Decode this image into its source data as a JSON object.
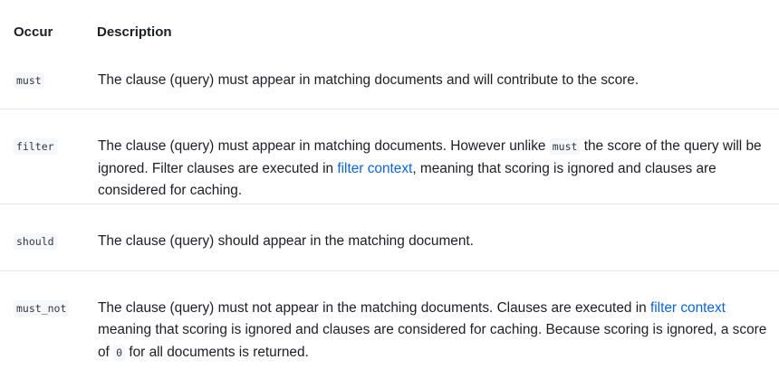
{
  "table": {
    "headers": {
      "occur": "Occur",
      "description": "Description"
    },
    "rows": [
      {
        "occur": "must",
        "desc": {
          "t1": "The clause (query) must appear in matching documents and will contribute to the score."
        }
      },
      {
        "occur": "filter",
        "desc": {
          "t1": "The clause (query) must appear in matching documents. However unlike ",
          "code": "must",
          "t2": " the score of the query will be ignored. Filter clauses are executed in ",
          "link": "filter context",
          "t3": ", meaning that scoring is ignored and clauses are considered for caching."
        }
      },
      {
        "occur": "should",
        "desc": {
          "t1": "The clause (query) should appear in the matching document."
        }
      },
      {
        "occur": "must_not",
        "desc": {
          "t1": "The clause (query) must not appear in the matching documents. Clauses are executed in ",
          "link": "filter context",
          "t2": " meaning that scoring is ignored and clauses are considered for caching. Because scoring is ignored, a score of ",
          "code": "0",
          "t3": " for all documents is returned."
        }
      }
    ]
  },
  "colors": {
    "text": "#1d1e24",
    "link": "#0b64dd",
    "code_bg": "#f5f7fa",
    "divider": "#e5e7eb"
  }
}
